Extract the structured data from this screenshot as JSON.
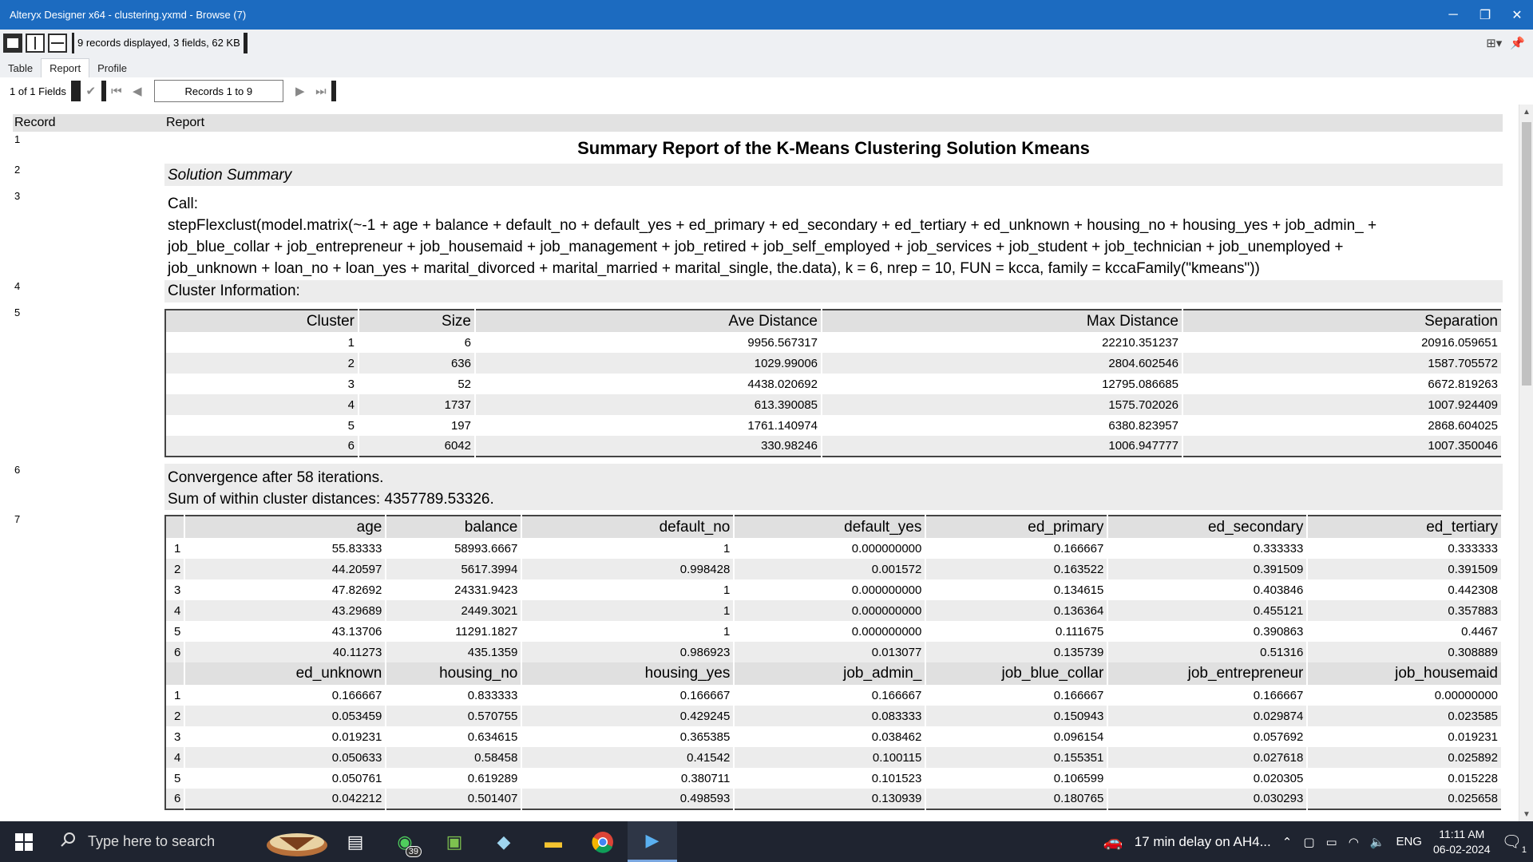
{
  "window": {
    "title": "Alteryx Designer x64 - clustering.yxmd - Browse (7)",
    "minimize": "─",
    "maximize": "❐",
    "close": "✕"
  },
  "toolbar": {
    "records_info": "9 records displayed, 3 fields, 62 KB"
  },
  "tabs": [
    {
      "label": "Table",
      "active": false
    },
    {
      "label": "Report",
      "active": true
    },
    {
      "label": "Profile",
      "active": false
    }
  ],
  "nav": {
    "fields": "1 of 1 Fields",
    "records": "Records 1 to 9"
  },
  "grid": {
    "col_record": "Record",
    "col_report": "Report"
  },
  "report": {
    "rows": [
      {
        "no": "1"
      },
      {
        "no": "2"
      },
      {
        "no": "3"
      },
      {
        "no": "4"
      },
      {
        "no": "5"
      },
      {
        "no": "6"
      },
      {
        "no": "7"
      }
    ],
    "title": "Summary Report of the K-Means Clustering Solution Kmeans",
    "solution_summary": "Solution Summary",
    "call_label": "Call:",
    "call_line1": "stepFlexclust(model.matrix(~-1 + age + balance + default_no + default_yes + ed_primary + ed_secondary + ed_tertiary + ed_unknown + housing_no + housing_yes + job_admin_ +",
    "call_line2": "job_blue_collar + job_entrepreneur + job_housemaid + job_management + job_retired + job_self_employed + job_services + job_student + job_technician + job_unemployed +",
    "call_line3": "job_unknown + loan_no + loan_yes + marital_divorced + marital_married + marital_single, the.data), k = 6, nrep = 10, FUN = kcca, family = kccaFamily(\"kmeans\"))",
    "cluster_info": "Cluster Information:",
    "cluster_table": {
      "headers": [
        "Cluster",
        "Size",
        "Ave Distance",
        "Max Distance",
        "Separation"
      ],
      "rows": [
        [
          "1",
          "6",
          "9956.567317",
          "22210.351237",
          "20916.059651"
        ],
        [
          "2",
          "636",
          "1029.99006",
          "2804.602546",
          "1587.705572"
        ],
        [
          "3",
          "52",
          "4438.020692",
          "12795.086685",
          "6672.819263"
        ],
        [
          "4",
          "1737",
          "613.390085",
          "1575.702026",
          "1007.924409"
        ],
        [
          "5",
          "197",
          "1761.140974",
          "6380.823957",
          "2868.604025"
        ],
        [
          "6",
          "6042",
          "330.98246",
          "1006.947777",
          "1007.350046"
        ]
      ]
    },
    "convergence": "Convergence after 58 iterations.",
    "sum_within": "Sum of within cluster distances: 4357789.53326.",
    "centers_table1": {
      "headers": [
        "age",
        "balance",
        "default_no",
        "default_yes",
        "ed_primary",
        "ed_secondary",
        "ed_tertiary"
      ],
      "rows": [
        [
          "1",
          "55.83333",
          "58993.6667",
          "1",
          "0.000000000",
          "0.166667",
          "0.333333",
          "0.333333"
        ],
        [
          "2",
          "44.20597",
          "5617.3994",
          "0.998428",
          "0.001572",
          "0.163522",
          "0.391509",
          "0.391509"
        ],
        [
          "3",
          "47.82692",
          "24331.9423",
          "1",
          "0.000000000",
          "0.134615",
          "0.403846",
          "0.442308"
        ],
        [
          "4",
          "43.29689",
          "2449.3021",
          "1",
          "0.000000000",
          "0.136364",
          "0.455121",
          "0.357883"
        ],
        [
          "5",
          "43.13706",
          "11291.1827",
          "1",
          "0.000000000",
          "0.111675",
          "0.390863",
          "0.4467"
        ],
        [
          "6",
          "40.11273",
          "435.1359",
          "0.986923",
          "0.013077",
          "0.135739",
          "0.51316",
          "0.308889"
        ]
      ]
    },
    "centers_table2": {
      "headers": [
        "ed_unknown",
        "housing_no",
        "housing_yes",
        "job_admin_",
        "job_blue_collar",
        "job_entrepreneur",
        "job_housemaid"
      ],
      "rows": [
        [
          "1",
          "0.166667",
          "0.833333",
          "0.166667",
          "0.166667",
          "0.166667",
          "0.166667",
          "0.00000000"
        ],
        [
          "2",
          "0.053459",
          "0.570755",
          "0.429245",
          "0.083333",
          "0.150943",
          "0.029874",
          "0.023585"
        ],
        [
          "3",
          "0.019231",
          "0.634615",
          "0.365385",
          "0.038462",
          "0.096154",
          "0.057692",
          "0.019231"
        ],
        [
          "4",
          "0.050633",
          "0.58458",
          "0.41542",
          "0.100115",
          "0.155351",
          "0.027618",
          "0.025892"
        ],
        [
          "5",
          "0.050761",
          "0.619289",
          "0.380711",
          "0.101523",
          "0.106599",
          "0.020305",
          "0.015228"
        ],
        [
          "6",
          "0.042212",
          "0.501407",
          "0.498593",
          "0.130939",
          "0.180765",
          "0.030293",
          "0.025658"
        ]
      ]
    }
  },
  "taskbar": {
    "search_placeholder": "Type here to search",
    "whatsapp_badge": "39",
    "notification": "17 min delay on AH4...",
    "language": "ENG",
    "time": "11:11 AM",
    "date": "06-02-2024",
    "notif_count": "1"
  },
  "colors": {
    "titlebar": "#1c6bc0",
    "header_shade": "#e2e2e2",
    "row_shade": "#ececec",
    "taskbar": "#1f2430"
  }
}
